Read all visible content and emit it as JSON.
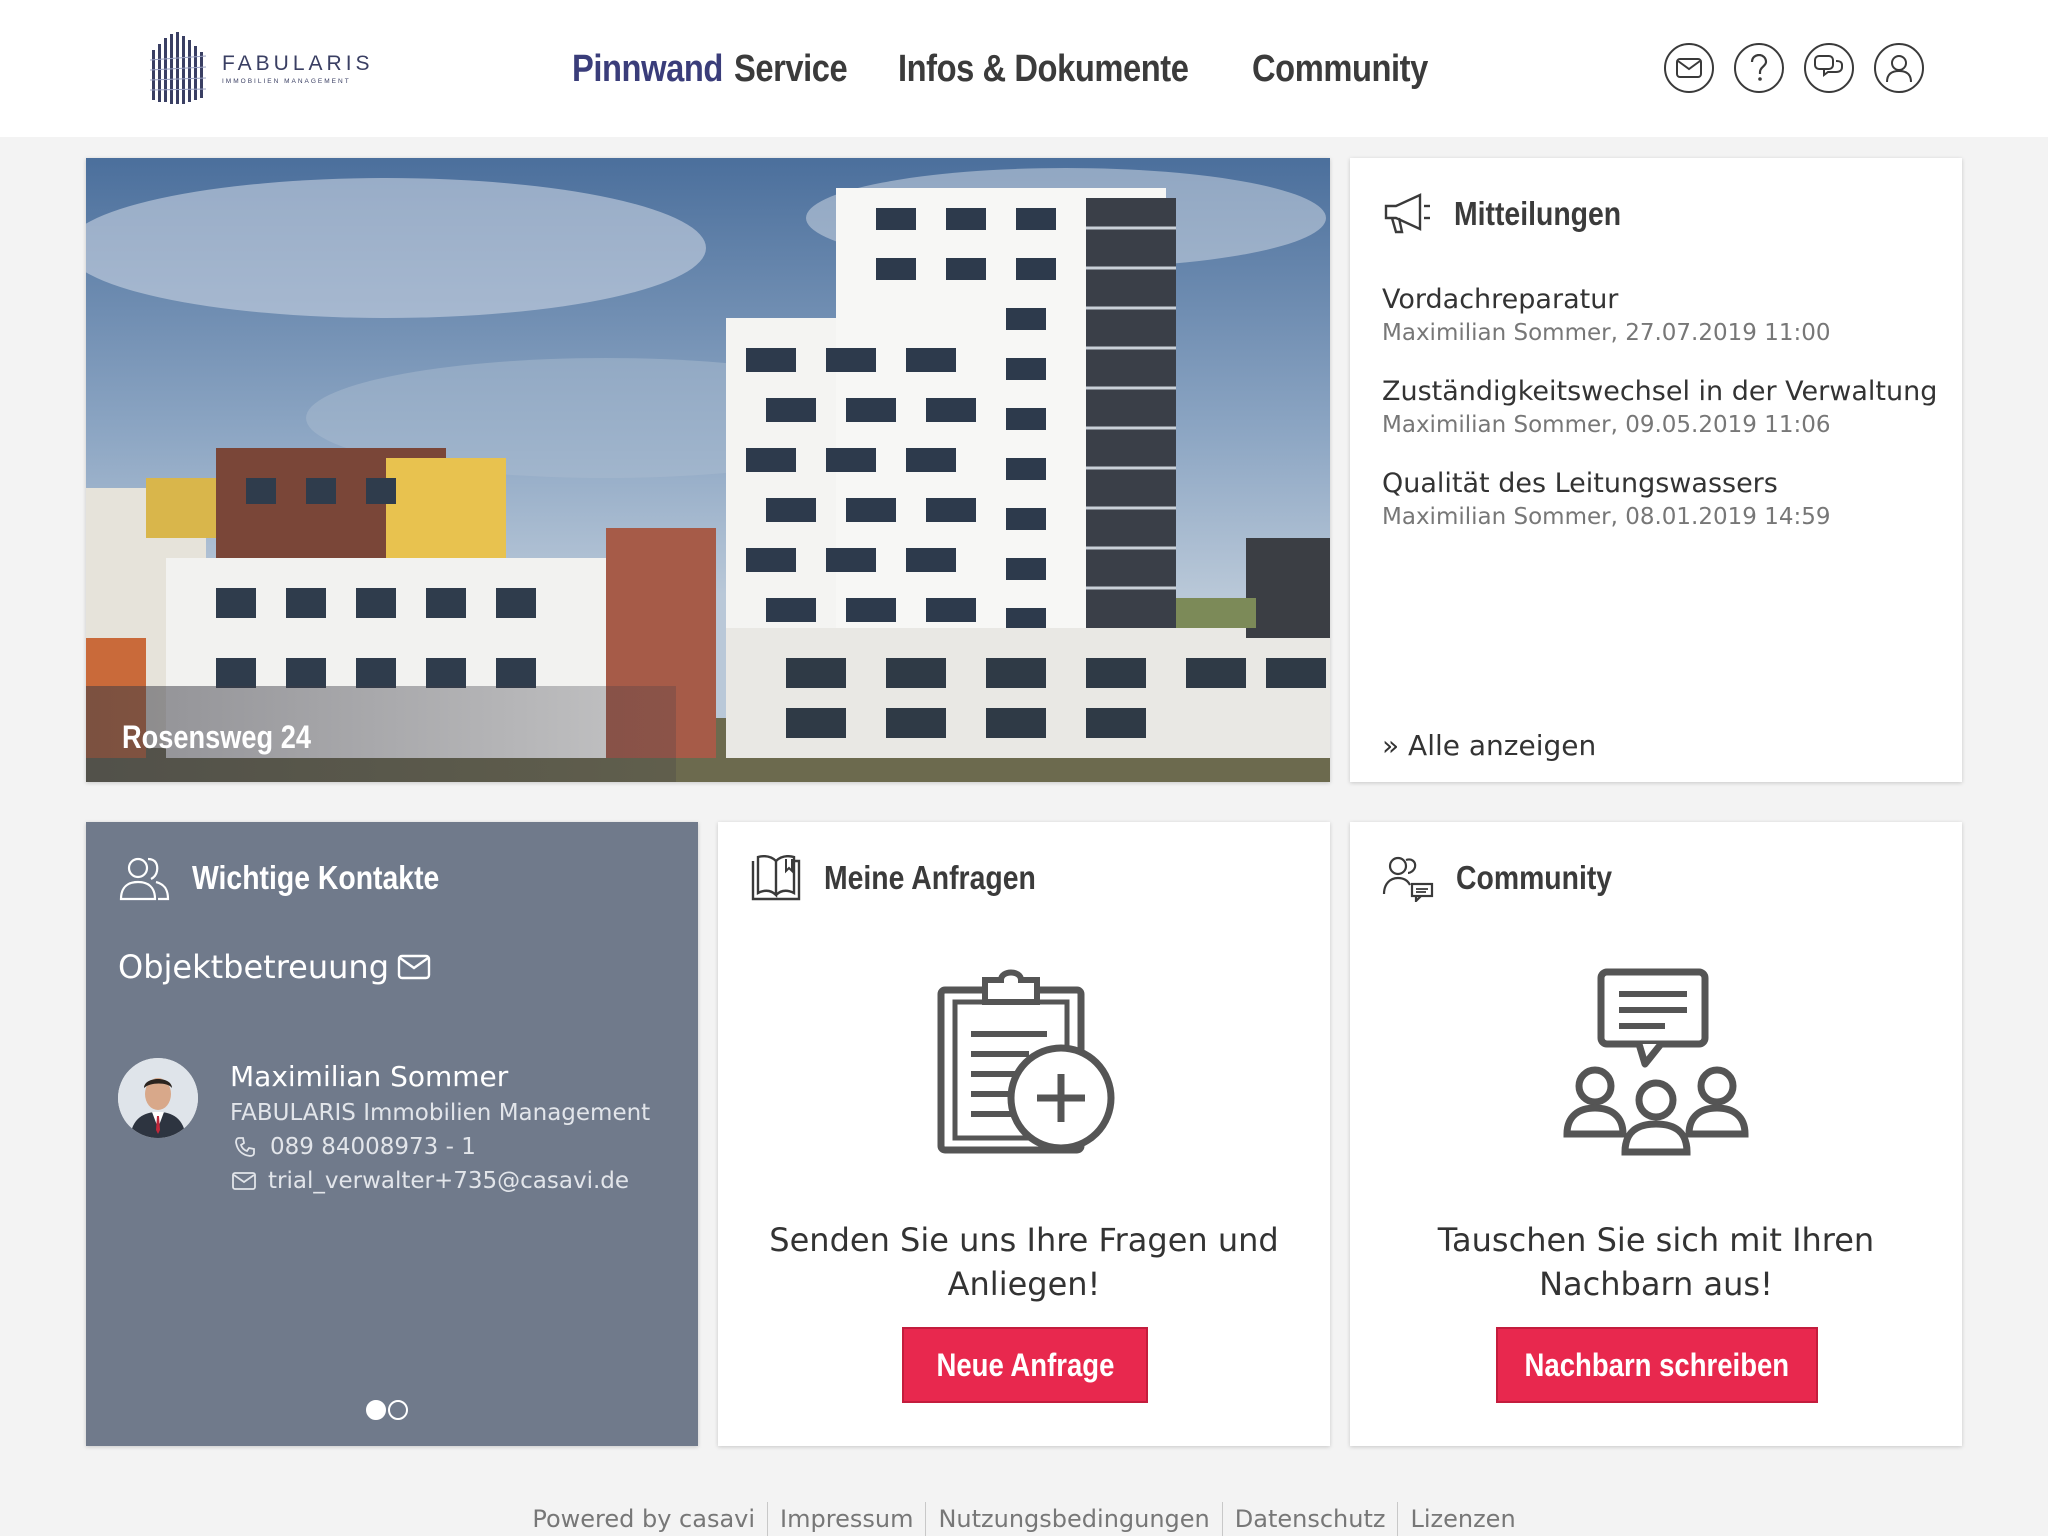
{
  "brand": {
    "name": "FABULARIS",
    "subtitle": "IMMOBILIEN MANAGEMENT",
    "accent_color": "#3a3d7a",
    "cta_color": "#e8284e"
  },
  "nav": {
    "items": [
      {
        "label": "Pinnwand",
        "active": true
      },
      {
        "label": "Service",
        "active": false
      },
      {
        "label": "Infos & Dokumente",
        "active": false
      },
      {
        "label": "Community",
        "active": false
      }
    ]
  },
  "header_icons": [
    "mail-icon",
    "help-icon",
    "chat-icon",
    "user-icon"
  ],
  "hero": {
    "title": "Rosensweg 24"
  },
  "mitteilungen": {
    "title": "Mitteilungen",
    "icon": "megaphone-icon",
    "items": [
      {
        "title": "Vordachreparatur",
        "meta": "Maximilian Sommer, 27.07.2019 11:00"
      },
      {
        "title": "Zuständigkeitswechsel in der Verwaltung",
        "meta": "Maximilian Sommer, 09.05.2019 11:06"
      },
      {
        "title": "Qualität des Leitungswassers",
        "meta": "Maximilian Sommer, 08.01.2019 14:59"
      }
    ],
    "show_all": "Alle anzeigen"
  },
  "kontakte": {
    "title": "Wichtige Kontakte",
    "icon": "contacts-icon",
    "category": "Objektbetreuung",
    "person": {
      "name": "Maximilian Sommer",
      "company": "FABULARIS Immobilien Management",
      "phone": "089 84008973 - 1",
      "email": "trial_verwalter+735@casavi.de"
    },
    "page_count": 2,
    "active_page": 1
  },
  "anfragen": {
    "title": "Meine Anfragen",
    "icon": "book-icon",
    "text": "Senden Sie uns Ihre Fragen und Anliegen!",
    "button": "Neue Anfrage"
  },
  "community": {
    "title": "Community",
    "icon": "community-chat-icon",
    "text": "Tauschen Sie sich mit Ihren Nachbarn aus!",
    "button": "Nachbarn schreiben"
  },
  "footer": {
    "links": [
      "Powered by casavi",
      "Impressum",
      "Nutzungsbedingungen",
      "Datenschutz",
      "Lizenzen"
    ]
  }
}
